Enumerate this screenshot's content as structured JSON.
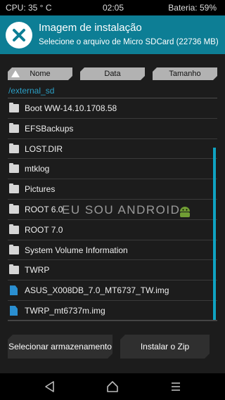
{
  "status": {
    "cpu": "CPU: 35 ° C",
    "time": "02:05",
    "battery": "Bateria: 59%"
  },
  "header": {
    "title": "Imagem de instalação",
    "subtitle": "Selecione o arquivo de Micro SDCard (22736 MB)",
    "logo_icon": "twrp-logo-icon"
  },
  "sort": {
    "name": "Nome",
    "date": "Data",
    "size": "Tamanho",
    "active_icon": "triangle-up-icon"
  },
  "path": "/external_sd",
  "files": [
    {
      "label": "Boot WW-14.10.1708.58",
      "icon": "folder-icon"
    },
    {
      "label": "EFSBackups",
      "icon": "folder-icon"
    },
    {
      "label": "LOST.DIR",
      "icon": "folder-icon"
    },
    {
      "label": "mtklog",
      "icon": "folder-icon"
    },
    {
      "label": "Pictures",
      "icon": "folder-icon"
    },
    {
      "label": "ROOT 6.0",
      "icon": "folder-icon"
    },
    {
      "label": "ROOT 7.0",
      "icon": "folder-icon"
    },
    {
      "label": "System Volume Information",
      "icon": "folder-icon"
    },
    {
      "label": "TWRP",
      "icon": "folder-icon"
    },
    {
      "label": "ASUS_X008DB_7.0_MT6737_TW.img",
      "icon": "file-icon"
    },
    {
      "label": "TWRP_mt6737m.img",
      "icon": "file-icon"
    }
  ],
  "watermark": "EU SOU ANDROID",
  "buttons": {
    "storage": "Selecionar armazenamento",
    "install": "Instalar o Zip"
  },
  "colors": {
    "header": "#0d7e95",
    "accent": "#0fa3c2",
    "path": "#2b9ec4",
    "file_icon": "#2a8fd1"
  }
}
